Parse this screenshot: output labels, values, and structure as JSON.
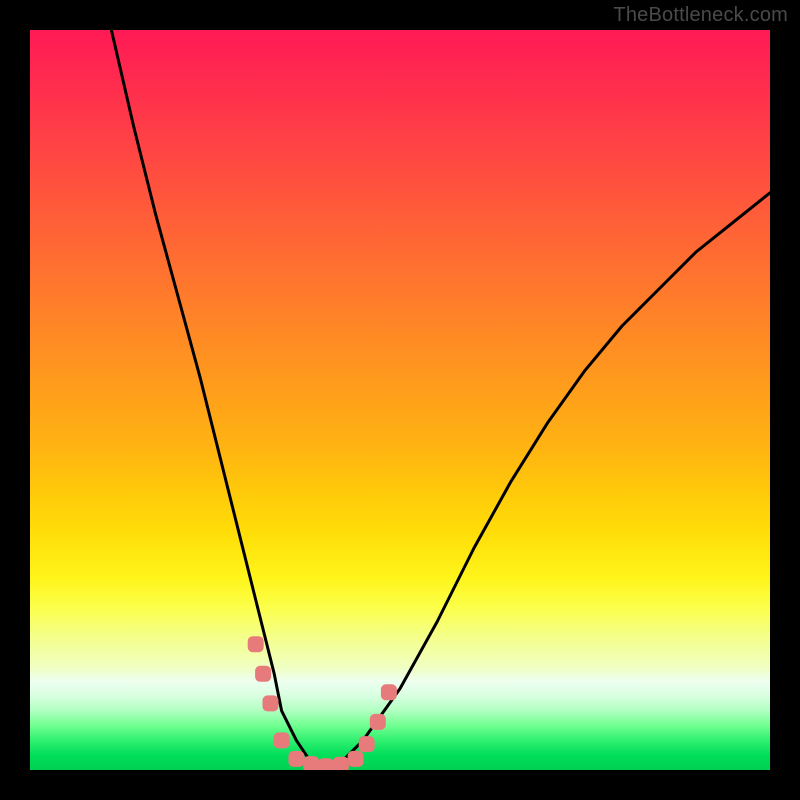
{
  "watermark": {
    "text": "TheBottleneck.com"
  },
  "chart_data": {
    "type": "line",
    "title": "",
    "xlabel": "",
    "ylabel": "",
    "xlim": [
      0,
      100
    ],
    "ylim": [
      0,
      100
    ],
    "background_gradient": {
      "direction": "vertical",
      "stops": [
        {
          "color": "#ff1a55",
          "pos": 0
        },
        {
          "color": "#ffde08",
          "pos": 68
        },
        {
          "color": "#fcff4a",
          "pos": 78
        },
        {
          "color": "#eefff0",
          "pos": 88
        },
        {
          "color": "#00d052",
          "pos": 100
        }
      ]
    },
    "series": [
      {
        "name": "bottleneck-curve",
        "color": "#000000",
        "x": [
          11,
          14,
          17,
          20,
          23,
          25,
          27,
          29,
          31,
          33,
          34,
          36,
          38,
          40,
          42,
          45,
          50,
          55,
          60,
          65,
          70,
          75,
          80,
          85,
          90,
          95,
          100
        ],
        "y": [
          100,
          87,
          75,
          64,
          53,
          45,
          37,
          29,
          21,
          13,
          8,
          4,
          1,
          0,
          1,
          4,
          11,
          20,
          30,
          39,
          47,
          54,
          60,
          65,
          70,
          74,
          78
        ]
      }
    ],
    "markers": [
      {
        "name": "sample-points",
        "color": "#e77a7a",
        "shape": "rounded-square",
        "points": [
          {
            "x": 30.5,
            "y": 17
          },
          {
            "x": 31.5,
            "y": 13
          },
          {
            "x": 32.5,
            "y": 9
          },
          {
            "x": 34.0,
            "y": 4
          },
          {
            "x": 36.0,
            "y": 1.5
          },
          {
            "x": 38.0,
            "y": 0.8
          },
          {
            "x": 40.0,
            "y": 0.5
          },
          {
            "x": 42.0,
            "y": 0.7
          },
          {
            "x": 44.0,
            "y": 1.5
          },
          {
            "x": 45.5,
            "y": 3.5
          },
          {
            "x": 47.0,
            "y": 6.5
          },
          {
            "x": 48.5,
            "y": 10.5
          }
        ]
      }
    ]
  }
}
